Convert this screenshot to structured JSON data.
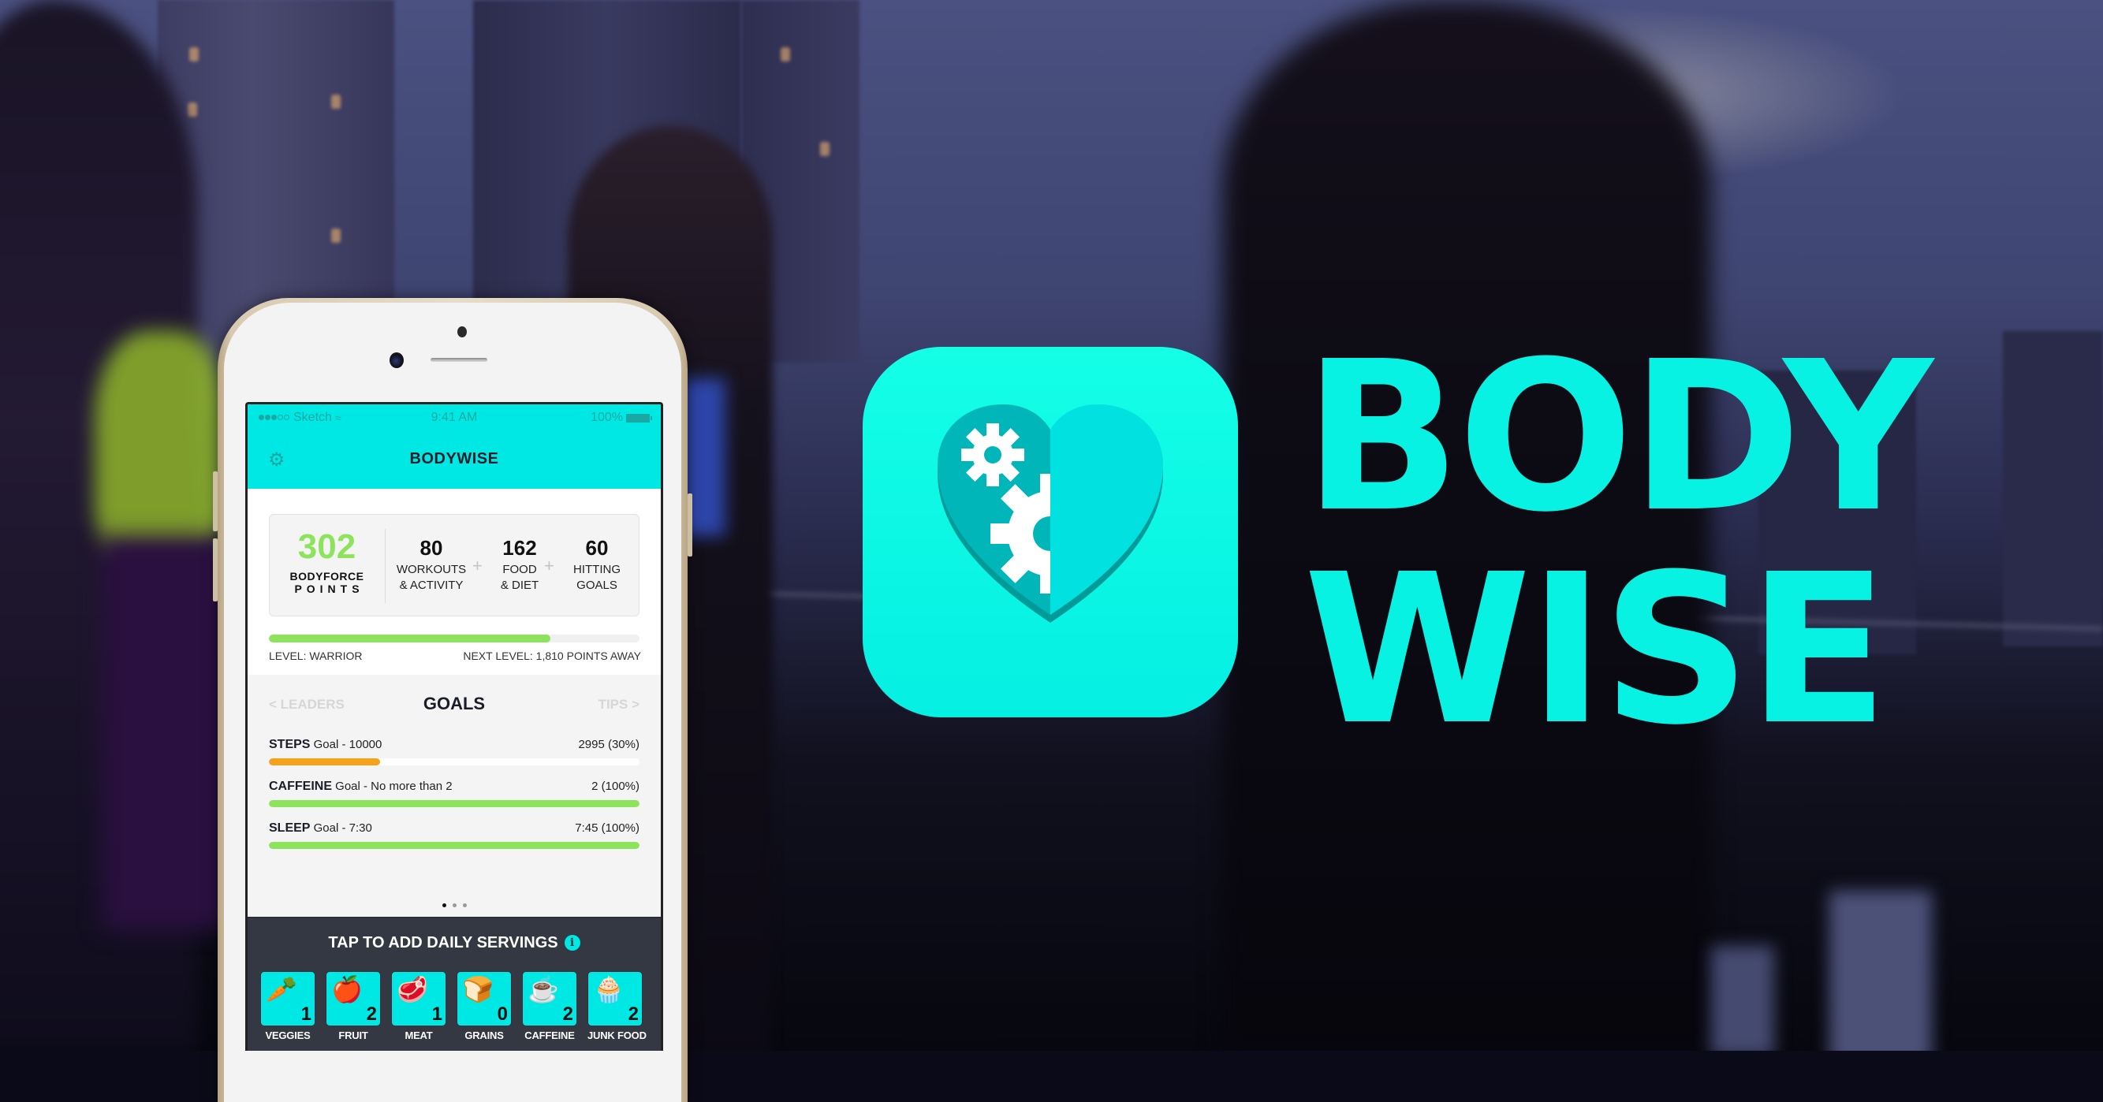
{
  "brand": {
    "line1": "BODY",
    "line2": "WISE",
    "accent_color": "#08f2e4",
    "icon": "heart-with-gears-icon"
  },
  "phone": {
    "status_bar": {
      "carrier": "Sketch",
      "signal_bars": 3,
      "signal_total": 5,
      "time": "9:41 AM",
      "battery": "100%"
    },
    "header": {
      "title": "BODYWISE",
      "settings_icon": "gear-icon",
      "color": "#00e8e3"
    },
    "stats": {
      "total_points": "302",
      "total_label_1": "BODYFORCE",
      "total_label_2": "POINTS",
      "breakdown": [
        {
          "value": "80",
          "label_1": "WORKOUTS",
          "label_2": "& ACTIVITY"
        },
        {
          "value": "162",
          "label_1": "FOOD",
          "label_2": "& DIET"
        },
        {
          "value": "60",
          "label_1": "HITTING",
          "label_2": "GOALS"
        }
      ],
      "plus_sign": "+",
      "level_progress": 0.76,
      "level_label": "LEVEL: WARRIOR",
      "next_level_label": "NEXT LEVEL: 1,810 POINTS AWAY"
    },
    "goals": {
      "title": "GOALS",
      "nav_left": "< LEADERS",
      "nav_right": "TIPS >",
      "items": [
        {
          "name": "STEPS",
          "goal": "Goal - 10000",
          "value": "2995 (30%)",
          "progress": 0.3,
          "color": "#f5a11c"
        },
        {
          "name": "CAFFEINE",
          "goal": "Goal - No more than 2",
          "value": "2 (100%)",
          "progress": 1.0,
          "color": "#8ee35d"
        },
        {
          "name": "SLEEP",
          "goal": "Goal - 7:30",
          "value": "7:45 (100%)",
          "progress": 1.0,
          "color": "#8ee35d"
        }
      ],
      "page_current": 1,
      "page_total": 3
    },
    "servings": {
      "title": "TAP TO ADD DAILY SERVINGS",
      "info_icon": "i",
      "items": [
        {
          "name": "VEGGIES",
          "count": "1",
          "icon": "carrot-icon",
          "glyph": "🥕"
        },
        {
          "name": "FRUIT",
          "count": "2",
          "icon": "apple-icon",
          "glyph": "🍎"
        },
        {
          "name": "MEAT",
          "count": "1",
          "icon": "steak-icon",
          "glyph": "🥩"
        },
        {
          "name": "GRAINS",
          "count": "0",
          "icon": "bread-icon",
          "glyph": "🍞"
        },
        {
          "name": "CAFFEINE",
          "count": "2",
          "icon": "coffee-cup-icon",
          "glyph": "☕"
        },
        {
          "name": "JUNK FOOD",
          "count": "2",
          "icon": "cupcake-icon",
          "glyph": "🧁"
        }
      ]
    }
  }
}
